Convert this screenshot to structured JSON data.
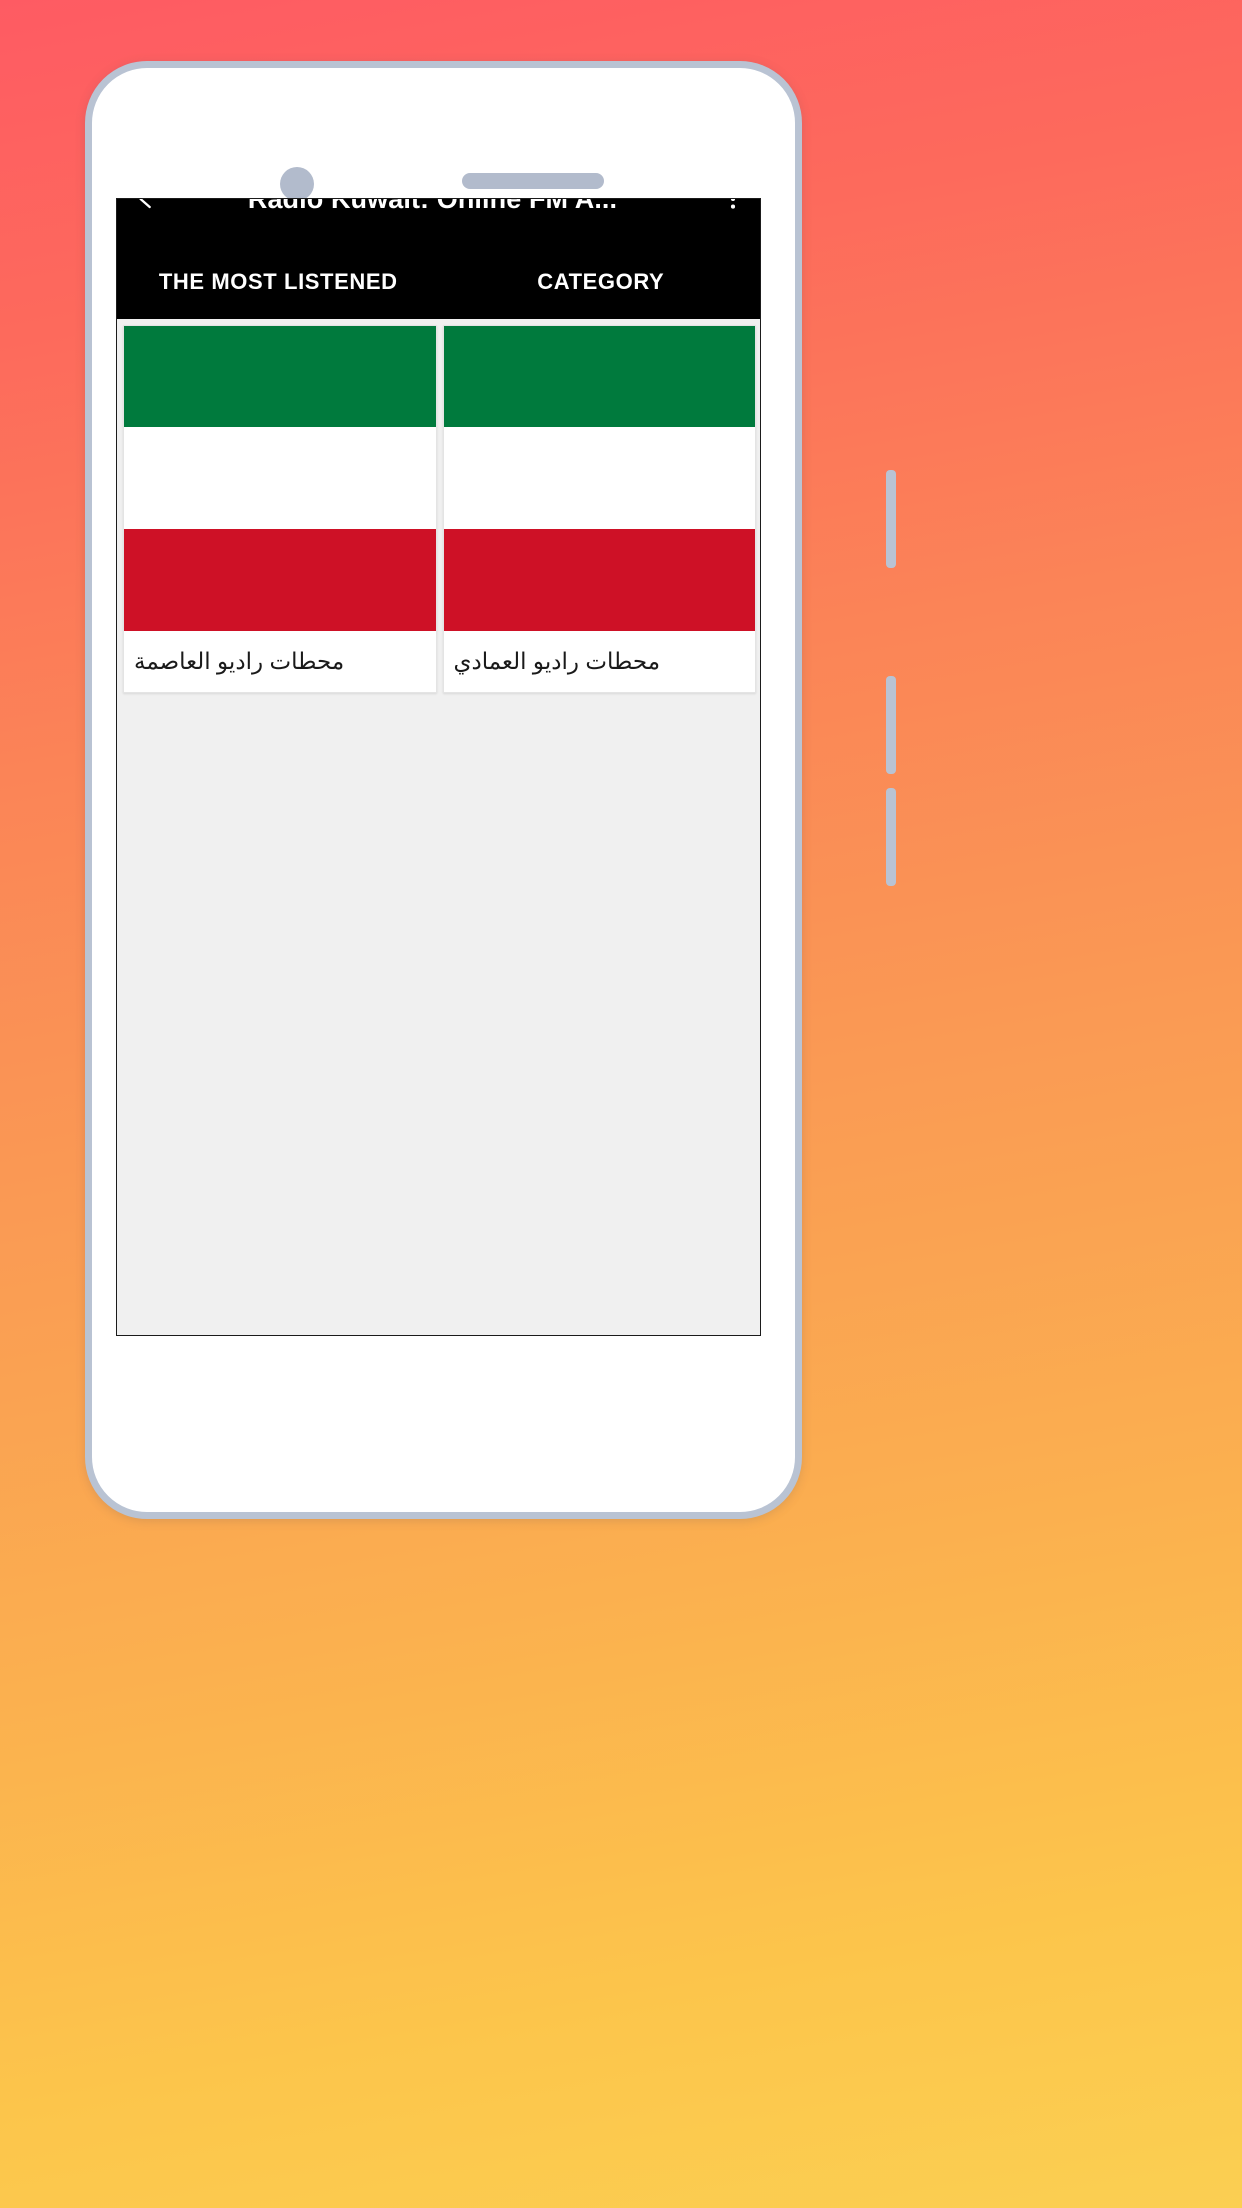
{
  "background": {
    "gradient_from": "#FE5B63",
    "gradient_to": "#FBCF52"
  },
  "device": {
    "frame_color": "#b9c3d3",
    "body_color": "#ffffff",
    "hardware": {
      "front_camera": "front-camera",
      "earpiece_speaker": "earpiece-speaker",
      "sensor": "sensor-pill",
      "side_buttons": 3
    }
  },
  "app": {
    "bar": {
      "background": "#000000",
      "title": "Radio Kuwait: Online FM A...",
      "back_icon": "back-arrow-icon",
      "overflow_icon": "overflow-menu-icon"
    },
    "tabs": [
      {
        "label": "THE MOST LISTENED",
        "selected": true
      },
      {
        "label": "CATEGORY",
        "selected": false
      }
    ],
    "content": {
      "background": "#f0f0f0",
      "cards": [
        {
          "label": "محطات راديو العاصمة",
          "flag": {
            "name": "kuwait-flag",
            "green": "#007A3D",
            "white": "#FFFFFF",
            "red": "#CE1126"
          }
        },
        {
          "label": "محطات راديو العمادي",
          "flag": {
            "name": "kuwait-flag",
            "green": "#007A3D",
            "white": "#FFFFFF",
            "red": "#CE1126"
          }
        }
      ]
    }
  }
}
